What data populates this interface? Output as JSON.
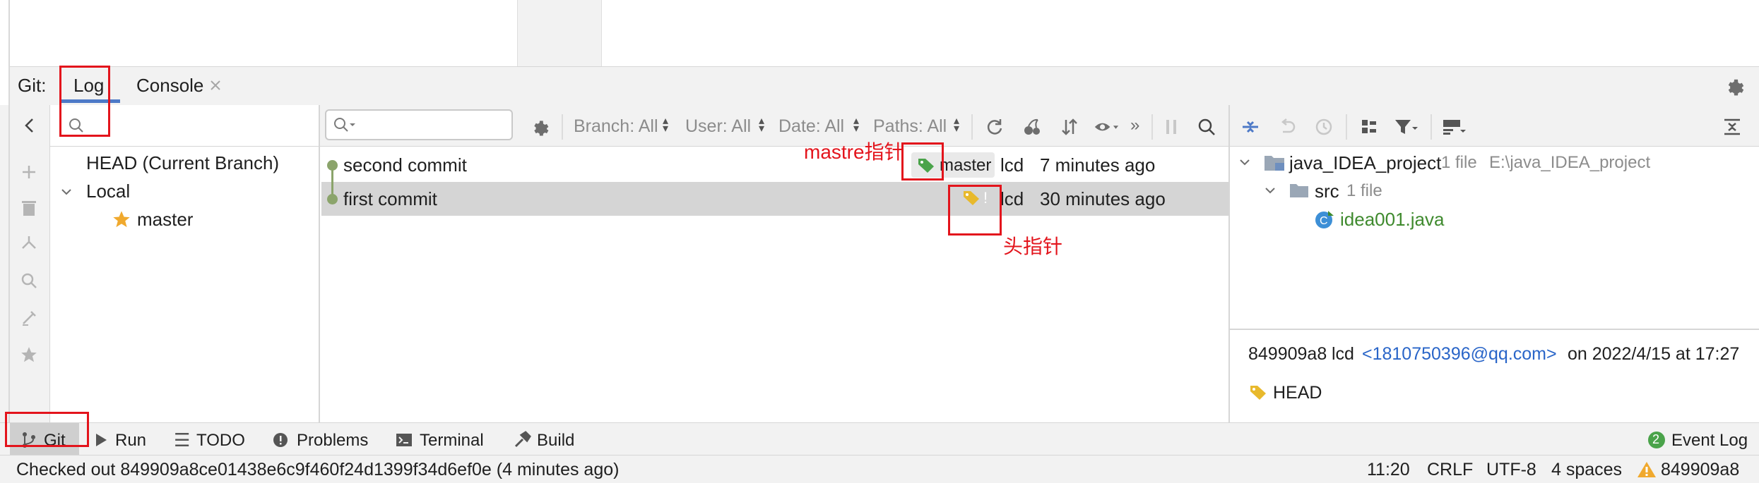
{
  "git_panel": {
    "title": "Git:",
    "tabs": [
      {
        "label": "Log"
      },
      {
        "label": "Console"
      }
    ]
  },
  "branches": {
    "head": "HEAD (Current Branch)",
    "local": "Local",
    "master": "master"
  },
  "log_toolbar": {
    "branch": "Branch: All",
    "user": "User: All",
    "date": "Date: All",
    "paths": "Paths: All"
  },
  "commits": [
    {
      "message": "second commit",
      "tag": "master",
      "author": "lcd",
      "time": "7 minutes ago"
    },
    {
      "message": "first commit",
      "tag": "!",
      "author": "lcd",
      "time": "30 minutes ago"
    }
  ],
  "annotations": {
    "master_pointer": "mastre指针",
    "head_pointer": "头指针"
  },
  "changes": {
    "project": "java_IDEA_project",
    "project_count": "1 file",
    "project_path": "E:\\java_IDEA_project",
    "src": "src",
    "src_count": "1 file",
    "file": "idea001.java"
  },
  "commit_details": {
    "hash": "849909a8",
    "author": "lcd",
    "email": "<1810750396@qq.com>",
    "date": "on 2022/4/15 at 17:27",
    "ref": "HEAD"
  },
  "tool_windows": {
    "git": "Git",
    "run": "Run",
    "todo": "TODO",
    "problems": "Problems",
    "terminal": "Terminal",
    "build": "Build",
    "event_log_count": "2",
    "event_log": "Event Log"
  },
  "status_bar": {
    "message": "Checked out 849909a8ce01438e6c9f460f24d1399f34d6ef0e (4 minutes ago)",
    "position": "11:20",
    "line_sep": "CRLF",
    "encoding": "UTF-8",
    "indent": "4 spaces",
    "branch": "849909a8"
  },
  "colors": {
    "accent": "#4d79c7",
    "graph_green": "#8ba46b",
    "tag_green": "#4aa34a",
    "tag_yellow": "#e8b92c",
    "link": "#2965c8",
    "file_green": "#3f8a2e",
    "annotation_red": "#e3141c"
  },
  "icons": [
    "search-icon",
    "gear-icon",
    "close-icon",
    "refresh-icon",
    "cherry-pick-icon",
    "sort-icon",
    "eye-icon",
    "more-icon",
    "pause-icon",
    "expand-icon",
    "undo-icon",
    "history-icon",
    "group-icon",
    "filter-icon",
    "preview-icon",
    "collapse-all-icon",
    "plus-icon",
    "trash-icon",
    "merge-icon",
    "edit-icon",
    "star-icon",
    "back-arrow-icon",
    "tag-icon",
    "folder-icon",
    "java-class-icon",
    "warning-icon"
  ]
}
